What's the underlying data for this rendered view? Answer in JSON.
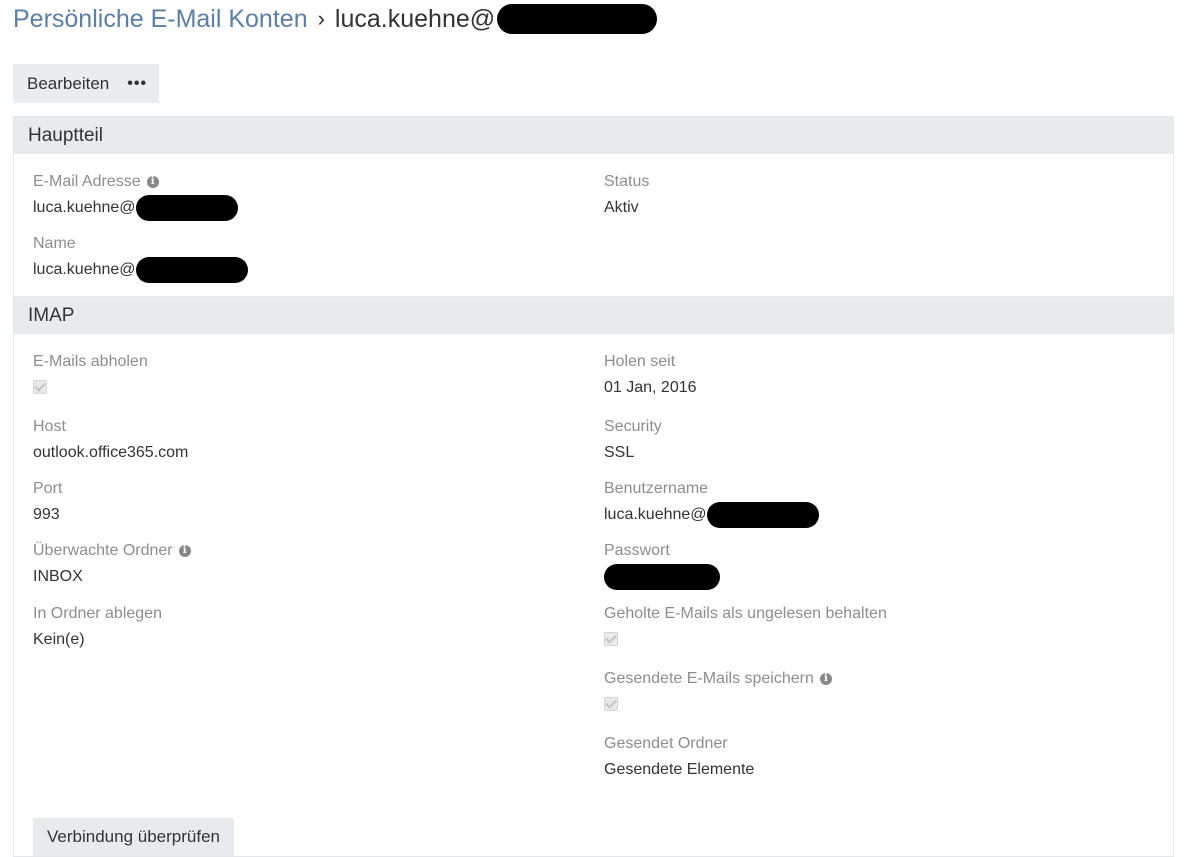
{
  "breadcrumb": {
    "parent": "Persönliche E-Mail Konten",
    "separator": "›",
    "current": "luca.kuehne@"
  },
  "toolbar": {
    "edit_label": "Bearbeiten",
    "more_label": "•••"
  },
  "main": {
    "title": "Hauptteil",
    "email_label": "E-Mail Adresse",
    "email_value": "luca.kuehne@",
    "name_label": "Name",
    "name_value": "luca.kuehne@",
    "status_label": "Status",
    "status_value": "Aktiv"
  },
  "imap": {
    "title": "IMAP",
    "fetch_label": "E-Mails abholen",
    "fetch_checked": true,
    "fetch_since_label": "Holen seit",
    "fetch_since_value": "01 Jan, 2016",
    "host_label": "Host",
    "host_value": "outlook.office365.com",
    "security_label": "Security",
    "security_value": "SSL",
    "port_label": "Port",
    "port_value": "993",
    "username_label": "Benutzername",
    "username_value": "luca.kuehne@",
    "monitored_label": "Überwachte Ordner",
    "monitored_value": "INBOX",
    "password_label": "Passwort",
    "move_label": "In Ordner ablegen",
    "move_value": "Kein(e)",
    "keep_unread_label": "Geholte E-Mails als ungelesen behalten",
    "keep_unread_checked": true,
    "store_sent_label": "Gesendete E-Mails speichern",
    "store_sent_checked": true,
    "sent_folder_label": "Gesendet Ordner",
    "sent_folder_value": "Gesendete Elemente",
    "verify_label": "Verbindung überprüfen"
  },
  "icons": {
    "info": "info-icon",
    "more": "more-dots-icon"
  },
  "colors": {
    "link": "#5a7fa8",
    "panel_header": "#e8ebed",
    "label": "#8d8d8d"
  }
}
